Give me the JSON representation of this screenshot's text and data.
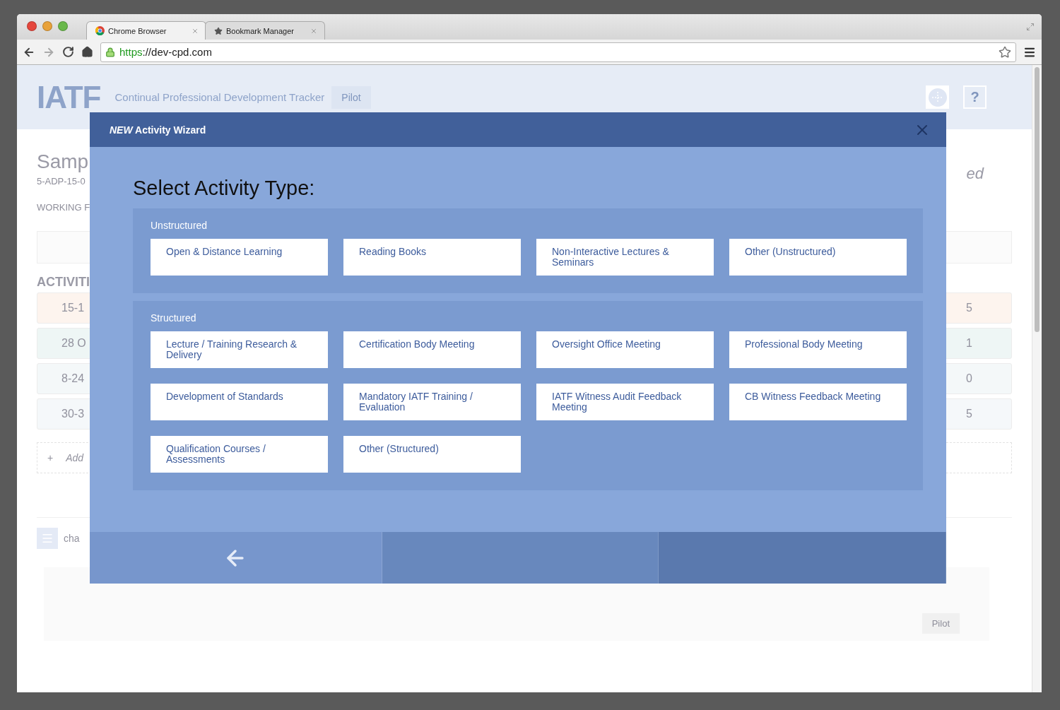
{
  "browser": {
    "tabs": [
      {
        "label": "Chrome Browser",
        "selected": true
      },
      {
        "label": "Bookmark Manager",
        "selected": false
      }
    ],
    "url_scheme": "https",
    "url_rest": "://dev-cpd.com"
  },
  "header": {
    "logo": "IATF",
    "subtitle": "Continual Professional Development Tracker",
    "badge": "Pilot",
    "help": "?"
  },
  "page": {
    "title": "Samp",
    "code": "5-ADP-15-0",
    "status": "WORKING F",
    "status_right": "ed",
    "activities_heading": "ACTIVITI",
    "activities": [
      {
        "date": "15-1",
        "value": "5",
        "color": "#fdf4ee"
      },
      {
        "date": "28 O",
        "value": "1",
        "color": "#eef6f5"
      },
      {
        "date": "8-24",
        "value": "0",
        "color": "#f4f8f9"
      },
      {
        "date": "30-3",
        "value": "5",
        "color": "#f5f8fa"
      }
    ],
    "add": {
      "icon": "+",
      "label": "Add"
    },
    "chat_label": "cha",
    "footer_badge": "Pilot"
  },
  "modal": {
    "title": "*NEW* Activity Wizard",
    "heading": "Select Activity Type:",
    "sections": [
      {
        "label": "Unstructured",
        "options": [
          "Open & Distance Learning",
          "Reading Books",
          "Non-Interactive Lectures & Seminars",
          "Other (Unstructured)"
        ]
      },
      {
        "label": "Structured",
        "options": [
          "Lecture / Training Research & Delivery",
          "Certification Body Meeting",
          "Oversight Office Meeting",
          "Professional Body Meeting",
          "Development of Standards",
          "Mandatory IATF Training / Evaluation",
          "IATF Witness Audit Feedback Meeting",
          "CB Witness Feedback Meeting",
          "Qualification Courses / Assessments",
          "Other (Structured)"
        ]
      }
    ]
  }
}
